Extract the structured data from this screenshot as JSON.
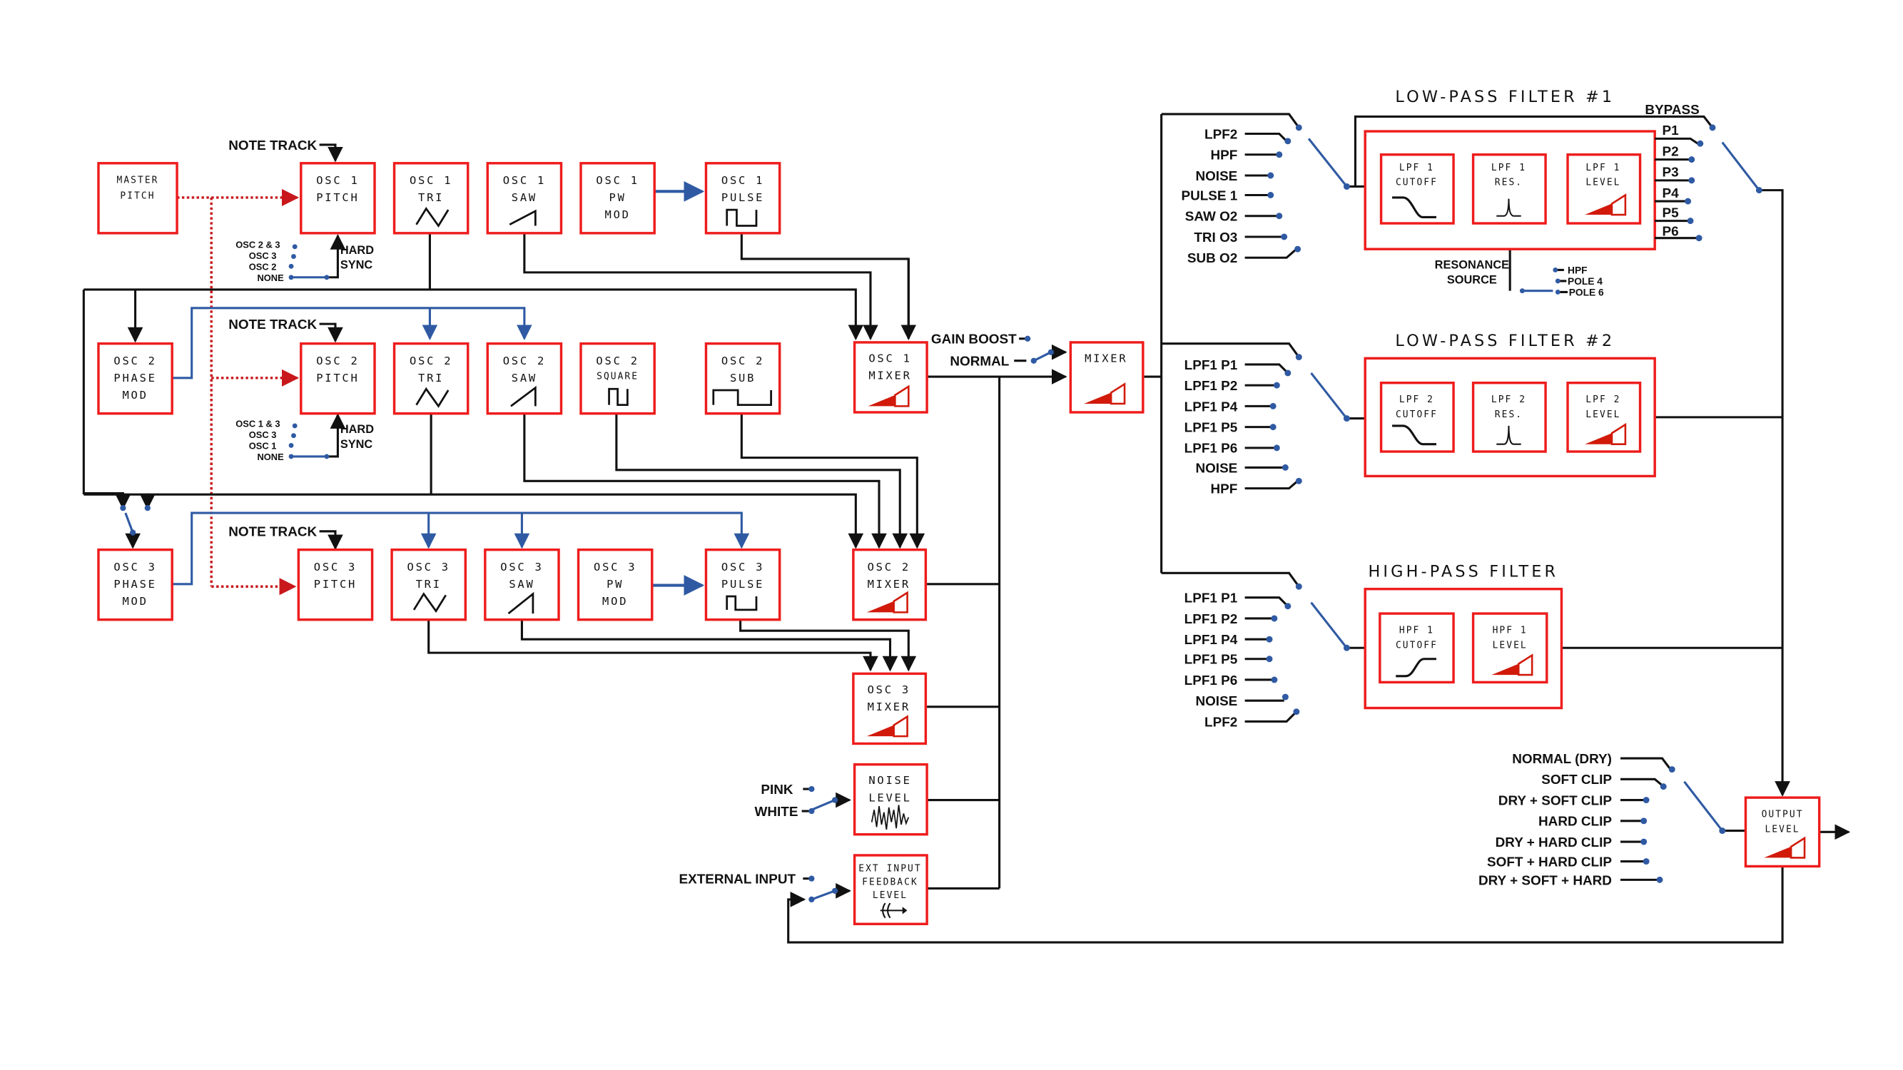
{
  "diagram": {
    "colors": {
      "block_border": "#ee1c1c",
      "wire": "#111111",
      "mod_wire": "#2f5aa3",
      "pitch_link": "#c8181c",
      "level_fill": "#d11a0a",
      "switch_dot": "#2f5aa3"
    },
    "master": {
      "l1": "MASTER",
      "l2": "PITCH"
    },
    "note_track": "NOTE TRACK",
    "hard_sync": {
      "l1": "HARD",
      "l2": "SYNC"
    },
    "osc1": {
      "pitch": {
        "l1": "OSC 1",
        "l2": "PITCH"
      },
      "tri": {
        "l1": "OSC 1",
        "l2": "TRI",
        "icon": "triangle-wave-icon"
      },
      "saw": {
        "l1": "OSC 1",
        "l2": "SAW",
        "icon": "saw-wave-icon"
      },
      "pwmod": {
        "l1": "OSC 1",
        "l2": "PW",
        "l3": "MOD"
      },
      "pulse": {
        "l1": "OSC 1",
        "l2": "PULSE",
        "icon": "pulse-wave-icon"
      },
      "mixer": {
        "l1": "OSC 1",
        "l2": "MIXER"
      },
      "sync_options": [
        "OSC 2 & 3",
        "OSC 3",
        "OSC 2",
        "NONE"
      ]
    },
    "osc2": {
      "phase": {
        "l1": "OSC 2",
        "l2": "PHASE",
        "l3": "MOD"
      },
      "pitch": {
        "l1": "OSC 2",
        "l2": "PITCH"
      },
      "tri": {
        "l1": "OSC 2",
        "l2": "TRI"
      },
      "saw": {
        "l1": "OSC 2",
        "l2": "SAW"
      },
      "square": {
        "l1": "OSC 2",
        "l2": "SQUARE"
      },
      "sub": {
        "l1": "OSC 2",
        "l2": "SUB"
      },
      "mixer": {
        "l1": "OSC 2",
        "l2": "MIXER"
      },
      "sync_options": [
        "OSC 1 & 3",
        "OSC 3",
        "OSC 1",
        "NONE"
      ]
    },
    "osc3": {
      "phase": {
        "l1": "OSC 3",
        "l2": "PHASE",
        "l3": "MOD"
      },
      "pitch": {
        "l1": "OSC 3",
        "l2": "PITCH"
      },
      "tri": {
        "l1": "OSC 3",
        "l2": "TRI"
      },
      "saw": {
        "l1": "OSC 3",
        "l2": "SAW"
      },
      "pwmod": {
        "l1": "OSC 3",
        "l2": "PW",
        "l3": "MOD"
      },
      "pulse": {
        "l1": "OSC 3",
        "l2": "PULSE"
      },
      "mixer": {
        "l1": "OSC 3",
        "l2": "MIXER"
      }
    },
    "noise": {
      "l1": "NOISE",
      "l2": "LEVEL",
      "options": [
        "PINK",
        "WHITE"
      ]
    },
    "ext": {
      "l1": "EXT INPUT",
      "l2": "FEEDBACK",
      "l3": "LEVEL",
      "input_label": "EXTERNAL INPUT"
    },
    "gain": {
      "options": [
        "GAIN BOOST",
        "NORMAL"
      ]
    },
    "mixer": {
      "l1": "MIXER"
    },
    "lpf1": {
      "title": "LOW-PASS FILTER #1",
      "inputs": [
        "LPF2",
        "HPF",
        "NOISE",
        "PULSE 1",
        "SAW O2",
        "TRI O3",
        "SUB O2"
      ],
      "cutoff": {
        "l1": "LPF 1",
        "l2": "CUTOFF"
      },
      "res": {
        "l1": "LPF 1",
        "l2": "RES."
      },
      "level": {
        "l1": "LPF 1",
        "l2": "LEVEL"
      },
      "bypass": "BYPASS",
      "poles": [
        "P1",
        "P2",
        "P3",
        "P4",
        "P5",
        "P6"
      ],
      "res_source": {
        "l1": "RESONANCE",
        "l2": "SOURCE",
        "options": [
          "HPF",
          "POLE 4",
          "POLE 6"
        ]
      }
    },
    "lpf2": {
      "title": "LOW-PASS FILTER #2",
      "inputs": [
        "LPF1 P1",
        "LPF1 P2",
        "LPF1 P4",
        "LPF1 P5",
        "LPF1 P6",
        "NOISE",
        "HPF"
      ],
      "cutoff": {
        "l1": "LPF 2",
        "l2": "CUTOFF"
      },
      "res": {
        "l1": "LPF 2",
        "l2": "RES."
      },
      "level": {
        "l1": "LPF 2",
        "l2": "LEVEL"
      }
    },
    "hpf": {
      "title": "HIGH-PASS FILTER",
      "inputs": [
        "LPF1 P1",
        "LPF1 P2",
        "LPF1 P4",
        "LPF1 P5",
        "LPF1 P6",
        "NOISE",
        "LPF2"
      ],
      "cutoff": {
        "l1": "HPF 1",
        "l2": "CUTOFF"
      },
      "level": {
        "l1": "HPF 1",
        "l2": "LEVEL"
      }
    },
    "output": {
      "l1": "OUTPUT",
      "l2": "LEVEL",
      "clip_options": [
        "NORMAL (DRY)",
        "SOFT CLIP",
        "DRY + SOFT CLIP",
        "HARD CLIP",
        "DRY + HARD CLIP",
        "SOFT + HARD CLIP",
        "DRY + SOFT + HARD"
      ]
    }
  }
}
